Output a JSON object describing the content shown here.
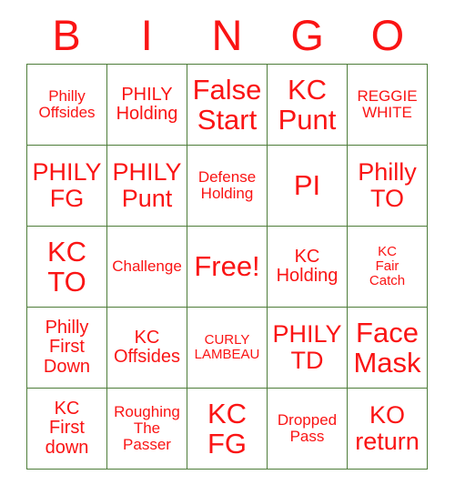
{
  "card": {
    "type": "bingo-card",
    "columns": 5,
    "rows": 5,
    "colors": {
      "text": "#fa1414",
      "grid_line": "#4e7d3a",
      "cell_background": "#ffffff",
      "page_background": "#ffffff"
    }
  },
  "header": {
    "letters": [
      "B",
      "I",
      "N",
      "G",
      "O"
    ]
  },
  "grid": {
    "cells": [
      {
        "text": "Philly\nOffsides",
        "size": "sm",
        "row": 1,
        "col": 1
      },
      {
        "text": "PHILY\nHolding",
        "size": "md",
        "row": 1,
        "col": 2
      },
      {
        "text": "False\nStart",
        "size": "xxl",
        "row": 1,
        "col": 3
      },
      {
        "text": "KC\nPunt",
        "size": "xxl",
        "row": 1,
        "col": 4
      },
      {
        "text": "REGGIE\nWHITE",
        "size": "sm",
        "row": 1,
        "col": 5
      },
      {
        "text": "PHILY\nFG",
        "size": "xl",
        "row": 2,
        "col": 1
      },
      {
        "text": "PHILY\nPunt",
        "size": "xl",
        "row": 2,
        "col": 2
      },
      {
        "text": "Defense\nHolding",
        "size": "sm",
        "row": 2,
        "col": 3
      },
      {
        "text": "PI",
        "size": "xxl",
        "row": 2,
        "col": 4
      },
      {
        "text": "Philly\nTO",
        "size": "xl",
        "row": 2,
        "col": 5
      },
      {
        "text": "KC\nTO",
        "size": "xxl",
        "row": 3,
        "col": 1
      },
      {
        "text": "Challenge",
        "size": "sm",
        "row": 3,
        "col": 2
      },
      {
        "text": "Free!",
        "size": "xxl",
        "row": 3,
        "col": 3
      },
      {
        "text": "KC\nHolding",
        "size": "md",
        "row": 3,
        "col": 4
      },
      {
        "text": "KC\nFair\nCatch",
        "size": "xs",
        "row": 3,
        "col": 5
      },
      {
        "text": "Philly\nFirst\nDown",
        "size": "md",
        "row": 4,
        "col": 1
      },
      {
        "text": "KC\nOffsides",
        "size": "md",
        "row": 4,
        "col": 2
      },
      {
        "text": "CURLY\nLAMBEAU",
        "size": "xs",
        "row": 4,
        "col": 3
      },
      {
        "text": "PHILY\nTD",
        "size": "xl",
        "row": 4,
        "col": 4
      },
      {
        "text": "Face\nMask",
        "size": "xxl",
        "row": 4,
        "col": 5
      },
      {
        "text": "KC\nFirst\ndown",
        "size": "md",
        "row": 5,
        "col": 1
      },
      {
        "text": "Roughing\nThe\nPasser",
        "size": "sm",
        "row": 5,
        "col": 2
      },
      {
        "text": "KC\nFG",
        "size": "xxl",
        "row": 5,
        "col": 3
      },
      {
        "text": "Dropped\nPass",
        "size": "sm",
        "row": 5,
        "col": 4
      },
      {
        "text": "KO\nreturn",
        "size": "xl",
        "row": 5,
        "col": 5
      }
    ]
  }
}
